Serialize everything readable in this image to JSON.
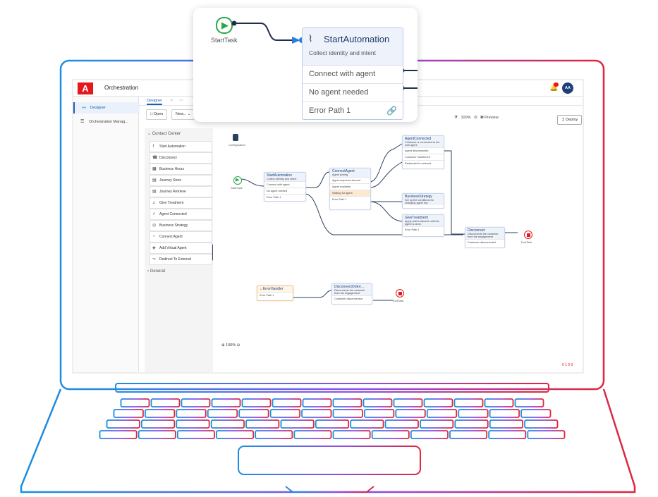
{
  "app": {
    "logo_letter": "A",
    "title": "Orchestration",
    "avatar_initials": "AA"
  },
  "sidenav": {
    "items": [
      {
        "label": "Designer",
        "active": true
      },
      {
        "label": "Orchestration Manag..."
      }
    ]
  },
  "tabs": [
    {
      "label": "Designer"
    }
  ],
  "toolbar": {
    "open_label": "Open",
    "new_label": "New...",
    "zoom_label": "100%",
    "preview_label": "Preview",
    "deploy_label": "Deploy"
  },
  "palette": {
    "section_contact_center": "Contact Center",
    "section_general": "General",
    "items": [
      {
        "label": "Start Automation",
        "icon": "automation-icon"
      },
      {
        "label": "Disconnect",
        "icon": "disconnect-icon"
      },
      {
        "label": "Business Hours",
        "icon": "building-icon"
      },
      {
        "label": "Journey Store",
        "icon": "journey-store-icon"
      },
      {
        "label": "Journey Retrieve",
        "icon": "journey-retrieve-icon"
      },
      {
        "label": "Give Treatment",
        "icon": "music-icon"
      },
      {
        "label": "Agent Connected",
        "icon": "check-icon"
      },
      {
        "label": "Business Strategy",
        "icon": "strategy-icon"
      },
      {
        "label": "Connect Agent",
        "icon": "headset-icon"
      },
      {
        "label": "Add Virtual Agent",
        "icon": "robot-icon"
      },
      {
        "label": "Redirect To External",
        "icon": "redirect-icon"
      }
    ]
  },
  "canvas": {
    "configuration_label": "Configuration",
    "start_label": "StartTask",
    "zoom_value": "100%",
    "status": "0 1 0 0",
    "nodes": {
      "start_automation": {
        "title": "StartAutomation",
        "sub": "Collect identity and intent",
        "rows": [
          "Connect with agent",
          "No agent needed",
          "Error Path 1"
        ]
      },
      "connect_agent": {
        "title": "ConnectAgent",
        "sub": "Agent joining",
        "rows": [
          "Agent response timeout",
          "Agent available",
          "Waiting for agent",
          "Error Path 1"
        ]
      },
      "agent_connected": {
        "title": "AgentConnected",
        "sub": "Customer is connected to the web agent",
        "rows": [
          "Agent disconnected",
          "Customer transferred",
          "Redirected to external"
        ]
      },
      "business_strategy": {
        "title": "BusinessStrategy",
        "sub": "Set up the conditions for changing agent rep."
      },
      "give_treatment": {
        "title": "GiveTreatment",
        "sub": "Apply wait treatment until the agent is done.",
        "rows": [
          "Error Path 1"
        ]
      },
      "disconnect": {
        "title": "Disconnect",
        "sub": "Disconnects the customer from the engagement",
        "rows": [
          "Customer disconnected"
        ]
      },
      "error_handler": {
        "title": "ErrorHandler",
        "rows": [
          "Error Path 1"
        ]
      },
      "disconnect_on_error": {
        "title": "DisconnectOnErr...",
        "sub": "Disconnects the customer from the engagement",
        "rows": [
          "Customer disconnected"
        ]
      },
      "end_label": "EndTask"
    }
  },
  "popup": {
    "start_label": "StartTask",
    "node_title": "StartAutomation",
    "node_sub": "Collect identity and intent",
    "rows": [
      "Connect with agent",
      "No agent needed",
      "Error Path 1"
    ]
  },
  "colors": {
    "brand_red": "#e5181d",
    "accent_blue": "#1a5fb4",
    "start_green": "#28a745",
    "end_red": "#e5181d",
    "gradient_start": "#1a8fe0",
    "gradient_mid": "#8a4fe8",
    "gradient_end": "#e0263c"
  }
}
